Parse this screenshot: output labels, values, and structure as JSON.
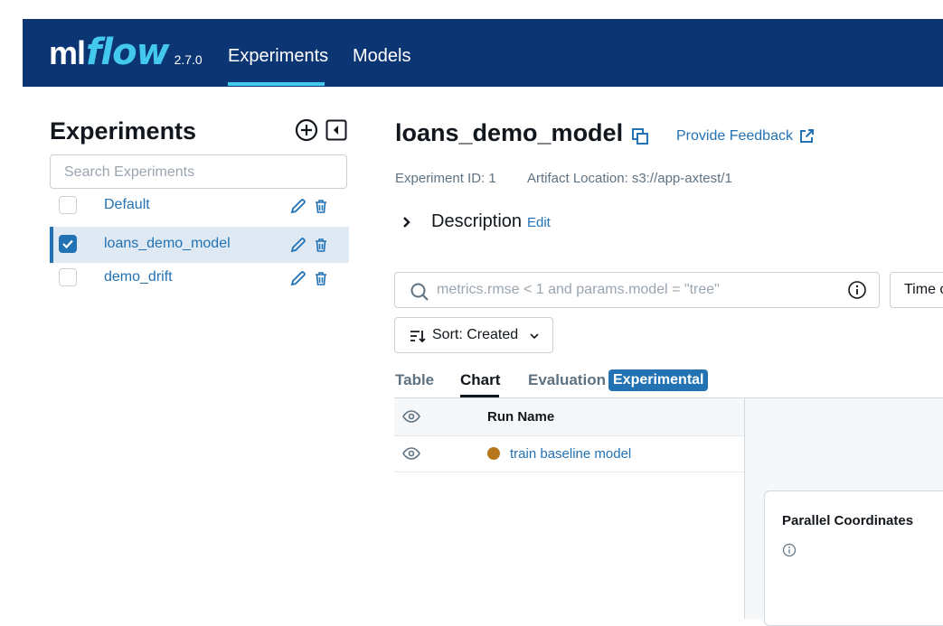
{
  "header": {
    "logo_ml": "ml",
    "logo_flow": "flow",
    "version": "2.7.0",
    "nav": [
      {
        "label": "Experiments",
        "active": true
      },
      {
        "label": "Models",
        "active": false
      }
    ]
  },
  "sidebar": {
    "title": "Experiments",
    "search_placeholder": "Search Experiments",
    "items": [
      {
        "label": "Default",
        "checked": false,
        "selected": false
      },
      {
        "label": "loans_demo_model",
        "checked": true,
        "selected": true
      },
      {
        "label": "demo_drift",
        "checked": false,
        "selected": false
      }
    ]
  },
  "main": {
    "title": "loans_demo_model",
    "feedback_label": "Provide Feedback",
    "experiment_id": "Experiment ID: 1",
    "artifact_location": "Artifact Location: s3://app-axtest/1",
    "description_label": "Description",
    "description_edit": "Edit",
    "search_placeholder": "metrics.rmse < 1 and params.model = \"tree\"",
    "time_label": "Time c",
    "sort_label": "Sort: Created",
    "tabs": [
      {
        "label": "Table",
        "active": false
      },
      {
        "label": "Chart",
        "active": true
      },
      {
        "label": "Evaluation",
        "active": false
      }
    ],
    "badge": "Experimental",
    "table": {
      "header_run_name": "Run Name",
      "rows": [
        {
          "run_name": "train baseline model",
          "color": "#b7781b"
        }
      ]
    },
    "chart_card": {
      "title": "Parallel Coordinates"
    }
  },
  "colors": {
    "header_bg": "#0c3574",
    "accent": "#43c9ed",
    "link": "#2272b4",
    "selected_bg": "#dfe9f3"
  }
}
